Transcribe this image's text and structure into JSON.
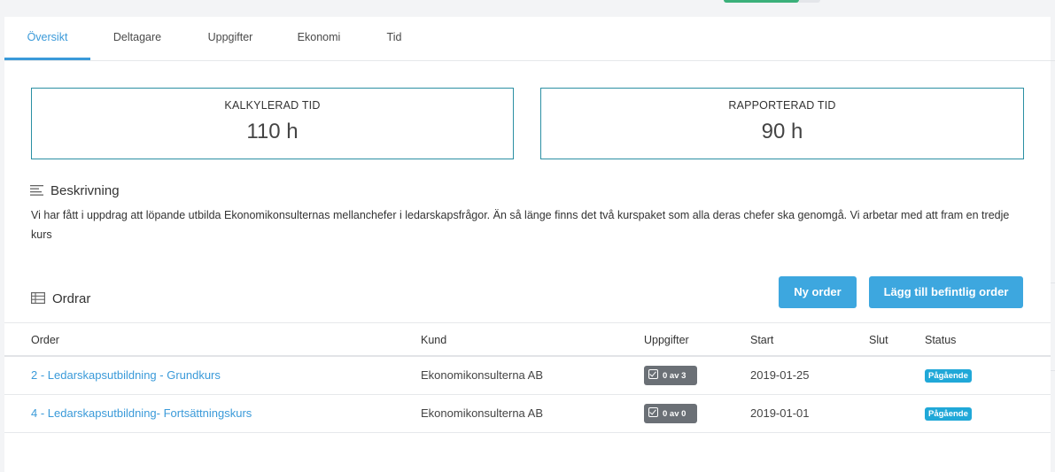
{
  "tabs": [
    {
      "label": "Översikt",
      "active": true
    },
    {
      "label": "Deltagare",
      "active": false
    },
    {
      "label": "Uppgifter",
      "active": false
    },
    {
      "label": "Ekonomi",
      "active": false
    },
    {
      "label": "Tid",
      "active": false
    }
  ],
  "stats": {
    "calculated": {
      "label": "KALKYLERAD TID",
      "value": "110 h"
    },
    "reported": {
      "label": "RAPPORTERAD TID",
      "value": "90 h"
    }
  },
  "description": {
    "title": "Beskrivning",
    "icon": "align-left-icon",
    "text": "Vi har fått i uppdrag att löpande utbilda Ekonomikonsulternas mellanchefer i ledarskapsfrågor. Än så länge finns det två kurspaket som alla deras chefer ska genomgå. Vi arbetar med att fram en tredje kurs"
  },
  "orders": {
    "title": "Ordrar",
    "icon": "table-icon",
    "new_order_label": "Ny order",
    "add_existing_label": "Lägg till befintlig order",
    "columns": {
      "order": "Order",
      "customer": "Kund",
      "tasks": "Uppgifter",
      "start": "Start",
      "end": "Slut",
      "status": "Status"
    },
    "rows": [
      {
        "order": "2 - Ledarskapsutbildning - Grundkurs",
        "customer": "Ekonomikonsulterna AB",
        "tasks": "0 av 3",
        "start": "2019-01-25",
        "end": "",
        "status": "Pågående"
      },
      {
        "order": "4 - Ledarskapsutbildning- Fortsättningskurs",
        "customer": "Ekonomikonsulterna AB",
        "tasks": "0 av 0",
        "start": "2019-01-01",
        "end": "",
        "status": "Pågående"
      }
    ]
  },
  "colors": {
    "accent": "#3a9ad9",
    "button": "#3da7df",
    "stat_border": "#2b8fa3",
    "status_badge": "#20a8d8",
    "task_badge": "#6b7076"
  }
}
